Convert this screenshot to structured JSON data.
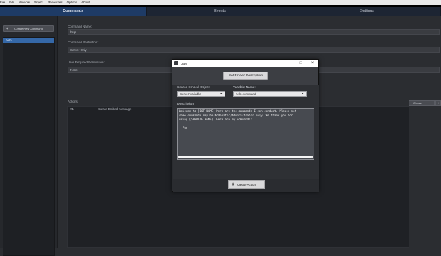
{
  "menu": [
    "File",
    "Edit",
    "Window",
    "Project",
    "Resources",
    "Options",
    "About"
  ],
  "tabs": [
    {
      "label": "Commands",
      "active": true
    },
    {
      "label": "Events",
      "active": false
    },
    {
      "label": "Settings",
      "active": false
    }
  ],
  "sidebar": {
    "new_command_label": "Create New Command",
    "commands": [
      "help"
    ]
  },
  "form": {
    "command_name_label": "Command Name:",
    "command_name_value": "help",
    "restriction_label": "Command Restriction:",
    "restriction_value": "Server Only",
    "permissions_label": "User Required Permission:",
    "permissions_value": "None"
  },
  "actions": {
    "label": "Actions",
    "rows": [
      {
        "num": "#1",
        "name": "Create Embed Message"
      }
    ],
    "create_label": "Create",
    "create_icon": "plus-icon"
  },
  "dialog": {
    "title": "DBM",
    "set_button": "Set Embed Description",
    "source_label": "Source Embed Object:",
    "source_value": "Server Variable",
    "variable_label": "Variable Name:",
    "variable_value": "help.command",
    "description_label": "Description:",
    "description_text": "Welcome to [BOT NAME] here are the commands I can conduct. Please not\nsome commands may be Moderator/Administrator only. We thank you for\nusing [SERVICE NAME]. Here are my commands:\n\n__Fun__",
    "create_action_label": "Create Action",
    "create_action_icon": "eye-icon"
  },
  "colors": {
    "accent": "#3568a8",
    "active_tab": "#1e3b66",
    "background": "#2b2d31"
  }
}
